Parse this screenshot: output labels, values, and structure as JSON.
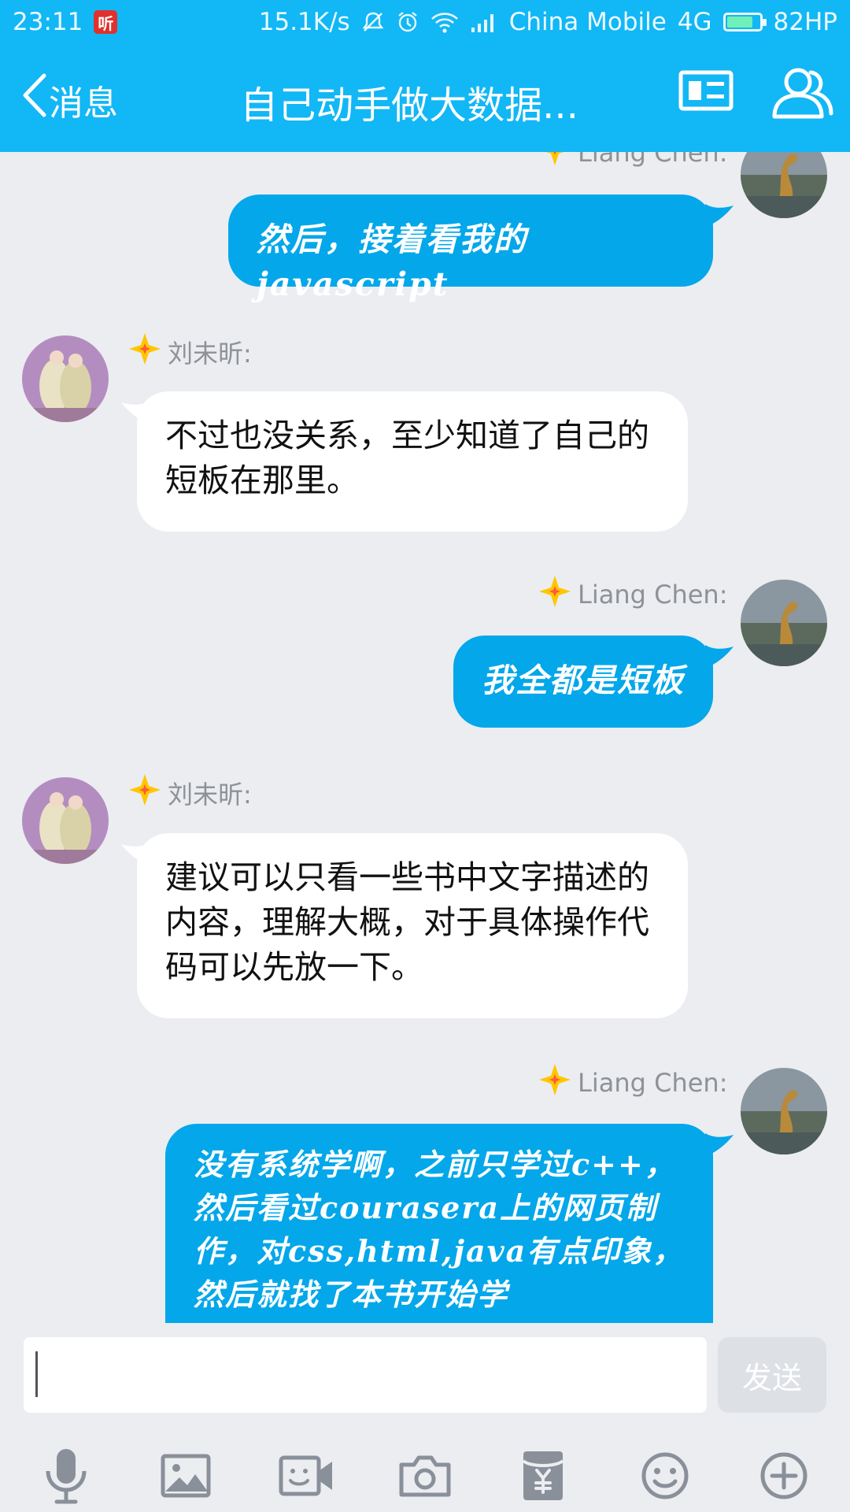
{
  "status_bar": {
    "time": "23:11",
    "app_badge": "听",
    "network_speed": "15.1K/s",
    "carrier": "China Mobile",
    "network_type": "4G",
    "battery": "82HP",
    "battery_level": 0.82,
    "icons": [
      "mute-icon",
      "alarm-icon",
      "wifi-icon",
      "signal-icon",
      "battery-icon"
    ]
  },
  "header": {
    "back_label": "消息",
    "title": "自己动手做大数据...",
    "icons": [
      "chevron-left-icon",
      "profile-card-icon",
      "group-members-icon"
    ]
  },
  "messages": [
    {
      "side": "right",
      "sender": "Liang Chen:",
      "text": "然后，接着看我的javascript"
    },
    {
      "side": "left",
      "sender": "刘未昕:",
      "text": "不过也没关系，至少知道了自己的短板在那里。"
    },
    {
      "side": "right",
      "sender": "Liang Chen:",
      "text": "我全都是短板"
    },
    {
      "side": "left",
      "sender": "刘未昕:",
      "text": "建议可以只看一些书中文字描述的内容，理解大概，对于具体操作代码可以先放一下。"
    },
    {
      "side": "right",
      "sender": "Liang Chen:",
      "text": "没有系统学啊，之前只学过c++，然后看过courasera上的网页制作，对css,html,java有点印象，然后就找了本书开始学"
    }
  ],
  "composer": {
    "value": "",
    "send_label": "发送"
  },
  "toolbar": {
    "icons": [
      "microphone-icon",
      "image-icon",
      "video-call-icon",
      "camera-icon",
      "red-packet-icon",
      "emoji-icon",
      "plus-icon"
    ]
  },
  "colors": {
    "header_bg": "#12b7f5",
    "own_bubble": "#03a7ea",
    "other_bubble": "#ffffff",
    "chat_bg": "#ebedf1",
    "badge_star": "#ffc700"
  }
}
